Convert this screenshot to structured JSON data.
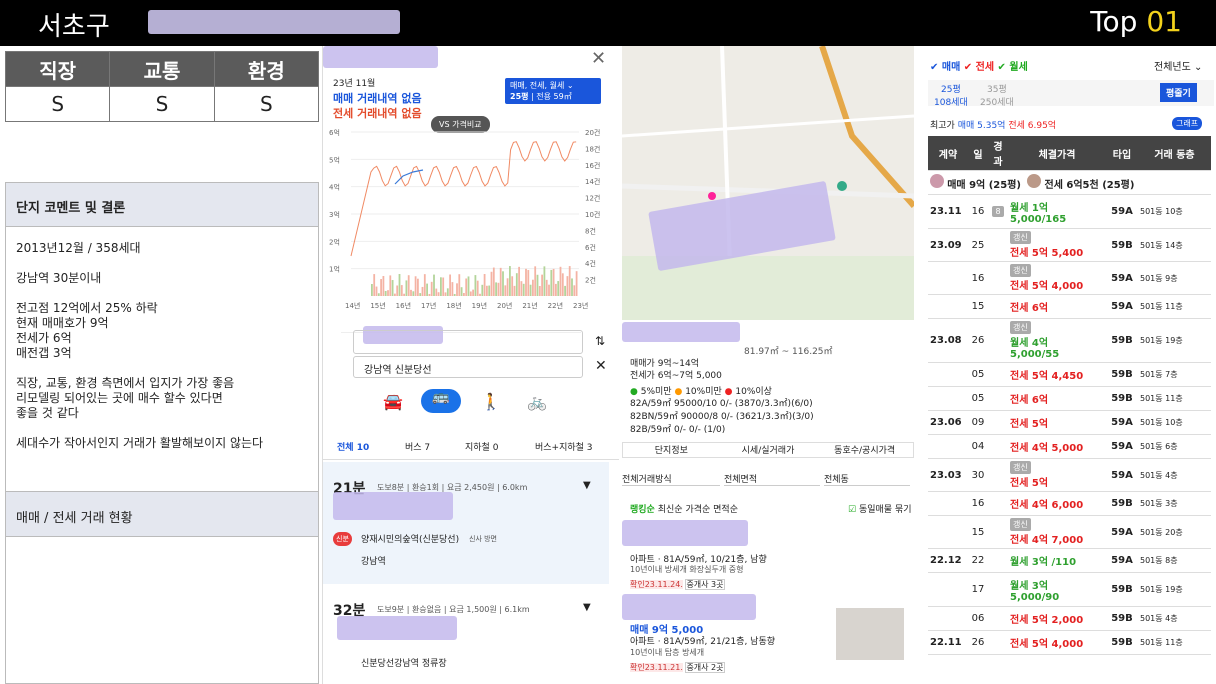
{
  "header": {
    "title": "서초구",
    "top_label": "Top",
    "top_num": "01"
  },
  "rating": {
    "headers": [
      "직장",
      "교통",
      "환경"
    ],
    "values": [
      "S",
      "S",
      "S"
    ]
  },
  "comment": {
    "title": "단지 코멘트 및 결론",
    "lines": [
      "2013년12월 / 358세대",
      "강남역 30분이내",
      "전고점 12억에서 25% 하락",
      "현재 매매호가 9억",
      "전세가 6억",
      "매전갭 3억",
      "직장, 교통, 환경 측면에서 입지가 가장 좋음",
      "리모델링 되어있는 곳에 매수 할수 있다면",
      "좋을 것 같다",
      "세대수가 작아서인지 거래가 활발해보이지 않는다"
    ],
    "section2": "매매 / 전세 거래 현황"
  },
  "price": {
    "month": "23년 11월",
    "no_sale": "매매 거래내역 없음",
    "no_jeonse": "전세 거래내역 없음",
    "filter": "매매, 전세, 월세",
    "size": "25평",
    "area": "전용 59㎡",
    "compare": "VS 가격비교"
  },
  "chart_data": {
    "type": "bar",
    "x": [
      "14년",
      "15년",
      "16년",
      "17년",
      "18년",
      "19년",
      "20년",
      "21년",
      "22년",
      "23년"
    ],
    "left_ticks": [
      "6억",
      "5억",
      "4억",
      "3억",
      "2억",
      "1억"
    ],
    "right_ticks": [
      "20건",
      "18건",
      "16건",
      "14건",
      "12건",
      "10건",
      "8건",
      "6건",
      "4건",
      "2건"
    ]
  },
  "route": {
    "dest": "강남역 신분당선",
    "tabs": [
      "전체 10",
      "버스 7",
      "지하철 0",
      "버스+지하철 3"
    ],
    "r1": {
      "time": "21분",
      "detail": "도보8분 | 환승1회 | 요금 2,450원 | 6.0km",
      "stop1": "양재시민의숲역(신분당선)",
      "dir": "신사 방면",
      "stop2": "강남역",
      "badge": "신분"
    },
    "r2": {
      "time": "32분",
      "detail": "도보9분 | 환승없음 | 요금 1,500원 | 6.1km",
      "stop": "신분당선강남역 정류장"
    }
  },
  "listing": {
    "area": "81.97㎡ ~ 116.25㎡",
    "sale": "매매가 9억~14억",
    "jeonse": "전세가 6억~7억 5,000",
    "legend": [
      "5%미만",
      "10%미만",
      "10%이상"
    ],
    "rows": [
      "82A/59㎡ 95000/10 0/- (3870/3.3㎡)(6/0)",
      "82BN/59㎡ 90000/8 0/- (3621/3.3㎡)(3/0)",
      "82B/59㎡ 0/- 0/- (1/0)"
    ],
    "tabs": [
      "단지정보",
      "시세/실거래가",
      "동호수/공시가격"
    ],
    "filters": [
      "전체거래방식",
      "전체면적",
      "전체동"
    ],
    "same": "동일매물 묶기",
    "sort": [
      "랭킹순",
      "최신순",
      "가격순",
      "면적순"
    ],
    "i1": {
      "desc": "아파트 · 81A/59㎡, 10/21층, 남향",
      "tags": "10년이내 방세개 화장실두개 중형",
      "date": "확인23.11.24.",
      "agent": "중개사 3곳"
    },
    "i2": {
      "price": "매매 9억 5,000",
      "desc": "아파트 · 81A/59㎡, 21/21층, 남동향",
      "tags": "10년이내 탑층 방세개",
      "date": "확인23.11.21.",
      "agent": "중개사 2곳"
    }
  },
  "trades": {
    "types": [
      "매매",
      "전세",
      "월세"
    ],
    "year": "전체년도",
    "size1": "25평",
    "hh1": "108세대",
    "size2": "35평",
    "hh2": "250세대",
    "btn": "평줄기",
    "high_label": "최고가",
    "high_sale": "매매 5.35억",
    "high_jeonse": "전세 6.95억",
    "graph": "그래프",
    "cols": [
      "계약",
      "일",
      "경과",
      "체결가격",
      "타입",
      "거래 동층"
    ],
    "sale_now": "매매 9억 (25평)",
    "jeonse_now": "전세 6억5천 (25평)",
    "rows": [
      {
        "m": "23.11",
        "d": "16",
        "k": "g",
        "p": "월세 1억",
        "p2": "5,000/165",
        "t": "59A",
        "f": "501동 10층",
        "new": "8"
      },
      {
        "m": "23.09",
        "d": "25",
        "k": "r",
        "tag": "갱신",
        "p": "전세 5억 5,400",
        "t": "59B",
        "f": "501동 14층"
      },
      {
        "m": "",
        "d": "16",
        "k": "r",
        "tag": "갱신",
        "p": "전세 5억 4,000",
        "t": "59A",
        "f": "501동 9층"
      },
      {
        "m": "",
        "d": "15",
        "k": "r",
        "p": "전세 6억",
        "t": "59A",
        "f": "501동 11층"
      },
      {
        "m": "23.08",
        "d": "26",
        "k": "g",
        "tag": "갱신",
        "p": "월세 4억",
        "p2": "5,000/55",
        "t": "59B",
        "f": "501동 19층"
      },
      {
        "m": "",
        "d": "05",
        "k": "r",
        "p": "전세 5억 4,450",
        "t": "59B",
        "f": "501동 7층"
      },
      {
        "m": "",
        "d": "05",
        "k": "r",
        "p": "전세 6억",
        "t": "59B",
        "f": "501동 11층"
      },
      {
        "m": "23.06",
        "d": "09",
        "k": "r",
        "p": "전세 5억",
        "t": "59A",
        "f": "501동 10층"
      },
      {
        "m": "",
        "d": "04",
        "k": "r",
        "p": "전세 4억 5,000",
        "t": "59A",
        "f": "501동 6층"
      },
      {
        "m": "23.03",
        "d": "30",
        "k": "r",
        "tag": "갱신",
        "p": "전세 5억",
        "t": "59A",
        "f": "501동 4층"
      },
      {
        "m": "",
        "d": "16",
        "k": "r",
        "p": "전세 4억 6,000",
        "t": "59B",
        "f": "501동 3층"
      },
      {
        "m": "",
        "d": "15",
        "k": "r",
        "tag": "갱신",
        "p": "전세 4억 7,000",
        "t": "59A",
        "f": "501동 20층"
      },
      {
        "m": "22.12",
        "d": "22",
        "k": "g",
        "p": "월세 3억 /110",
        "t": "59A",
        "f": "501동 8층"
      },
      {
        "m": "",
        "d": "17",
        "k": "g",
        "p": "월세 3억",
        "p2": "5,000/90",
        "t": "59B",
        "f": "501동 19층"
      },
      {
        "m": "",
        "d": "06",
        "k": "r",
        "p": "전세 5억 2,000",
        "t": "59B",
        "f": "501동 4층"
      },
      {
        "m": "22.11",
        "d": "26",
        "k": "r",
        "p": "전세 5억 4,000",
        "t": "59B",
        "f": "501동 11층"
      }
    ]
  }
}
